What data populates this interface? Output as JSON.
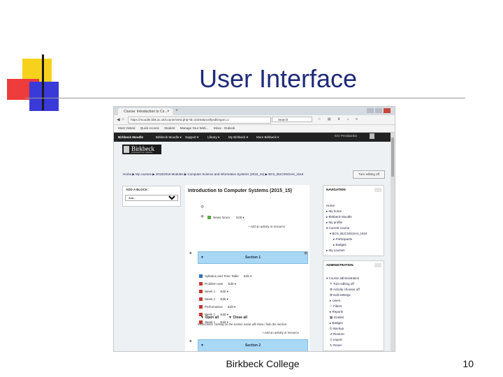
{
  "slide": {
    "title": "User Interface",
    "footer": "Birkbeck College",
    "page_number": "10"
  },
  "browser": {
    "tab_title": "Course: Introduction to Co...",
    "url": "https://moodle.bbk.ac.uk/course/view.php?id=33254&notifyeditingon=1",
    "search_placeholder": "Search",
    "bookmarks": [
      "Most Visited",
      "Quick Access",
      "Student",
      "Manage Your Web...",
      "Inbox - Outlook"
    ]
  },
  "moodle": {
    "brand": "Birkbeck Moodle",
    "menu": [
      "Birkbeck Moodle ▾",
      "Support ▾",
      "Library ▾",
      "My Birkbeck ▾",
      "More Birkbeck ▾"
    ],
    "user": "Eric Pendaanba",
    "logo": {
      "name": "Birkbeck",
      "sub": "UNIVERSITY OF LONDON"
    },
    "breadcrumb": "Home ▶ My courses ▶ 2015/2016 Modules ▶ Computer Science and Information Systems (2015_15) ▶ BCS_BUCS041H4_1516",
    "edit_button": "Turn editing off",
    "add_block": {
      "header": "ADD A BLOCK",
      "selected": "Add..."
    },
    "course_title": "Introduction to Computer Systems (2015_15)",
    "news": {
      "label": "News forum",
      "edit": "Edit ▾"
    },
    "add_activity": "+ Add an activity or resource",
    "open_all": "▼ Open all",
    "close_all": "▼ Close all",
    "instruction": "Instructions: clicking on the section name will show / hide the section.",
    "section1": "Section 1",
    "section2": "Section 2",
    "activities": [
      {
        "label": "Syllabus and Time Table",
        "edit": "Edit ▾"
      },
      {
        "label": "Problem sets",
        "edit": "Edit ▾"
      },
      {
        "label": "Week 1",
        "edit": "Edit ▾"
      },
      {
        "label": "Week 1",
        "edit": "Edit ▾"
      },
      {
        "label": "Performance",
        "edit": "Edit ▾"
      },
      {
        "label": "Week 1",
        "edit": "Edit ▾"
      },
      {
        "label": "Week 1",
        "edit": "Edit ▾"
      }
    ],
    "navigation": {
      "header": "NAVIGATION",
      "items": [
        "Home",
        "▸ My home",
        "▸ Birkbeck Moodle",
        "▸ My profile",
        "▾ Current course",
        "▾ BCS_BUCS041H4_1516",
        "▸ Participants",
        "▸ Badges",
        "▸ My courses"
      ]
    },
    "administration": {
      "header": "ADMINISTRATION",
      "items": [
        "▾ Course administration",
        "✎ Turn editing off",
        "⚙ Activity chooser off",
        "⚙ Edit settings",
        "▸ Users",
        "⊤ Filters",
        "▸ Reports",
        "▦ Grades",
        "▸ Badges",
        "↻ Backup",
        "↺ Restore",
        "↥ Import",
        "↻ Reset"
      ]
    },
    "colors": {
      "section_bar": "#a9d8f5",
      "topnav": "#222222"
    }
  }
}
